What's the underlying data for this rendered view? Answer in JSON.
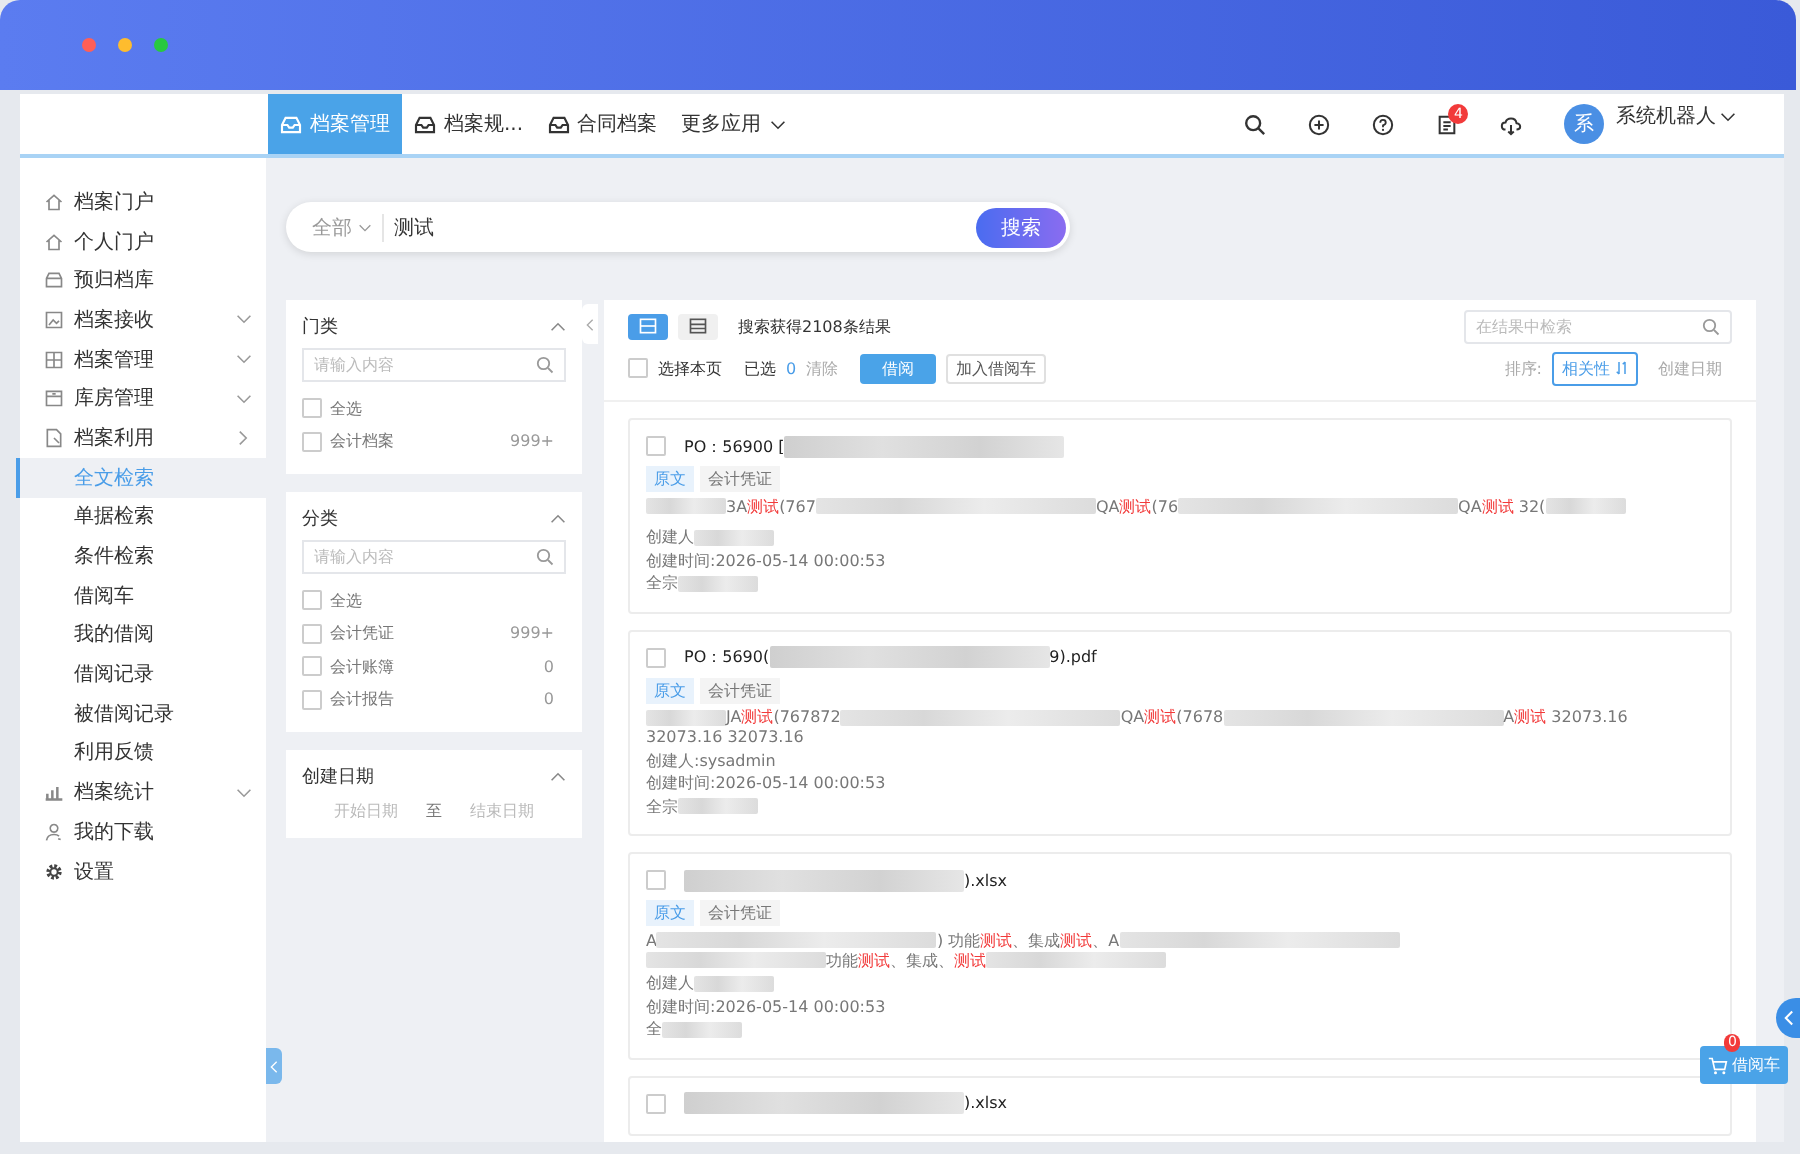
{
  "nav": {
    "tabs": [
      {
        "label": "档案管理",
        "selected": true
      },
      {
        "label": "档案规...",
        "selected": false
      },
      {
        "label": "合同档案",
        "selected": false
      }
    ],
    "more": "更多应用",
    "notification_count": "4",
    "avatar": "系",
    "user": "系统机器人"
  },
  "sidebar": {
    "items": [
      {
        "label": "档案门户"
      },
      {
        "label": "个人门户"
      },
      {
        "label": "预归档库"
      },
      {
        "label": "档案接收",
        "expanded": false
      },
      {
        "label": "档案管理",
        "expanded": false
      },
      {
        "label": "库房管理",
        "expanded": false
      },
      {
        "label": "档案利用",
        "expanded": true,
        "children": [
          {
            "label": "全文检索",
            "selected": true
          },
          {
            "label": "单据检索",
            "selected": false
          },
          {
            "label": "条件检索",
            "selected": false
          },
          {
            "label": "借阅车",
            "selected": false
          },
          {
            "label": "我的借阅",
            "selected": false
          },
          {
            "label": "借阅记录",
            "selected": false
          },
          {
            "label": "被借阅记录",
            "selected": false
          },
          {
            "label": "利用反馈",
            "selected": false
          }
        ]
      },
      {
        "label": "档案统计",
        "expanded": false
      },
      {
        "label": "我的下载"
      },
      {
        "label": "设置"
      }
    ]
  },
  "search": {
    "scope": "全部",
    "value": "测试",
    "button": "搜索"
  },
  "filters": [
    {
      "title": "门类",
      "placeholder": "请输入内容",
      "options": [
        {
          "label": "全选",
          "checked": false
        },
        {
          "label": "会计档案",
          "count": "999+",
          "checked": false
        }
      ]
    },
    {
      "title": "分类",
      "placeholder": "请输入内容",
      "options": [
        {
          "label": "全选",
          "checked": false
        },
        {
          "label": "会计凭证",
          "count": "999+",
          "checked": false
        },
        {
          "label": "会计账簿",
          "count": "0",
          "checked": false
        },
        {
          "label": "会计报告",
          "count": "0",
          "checked": false
        }
      ]
    }
  ],
  "date_filter": {
    "title": "创建日期",
    "start_placeholder": "开始日期",
    "separator": "至",
    "end_placeholder": "结束日期"
  },
  "results": {
    "summary": "搜索获得2108条结果",
    "select_page": "选择本页",
    "select_page_checked": false,
    "selected_label": "已选",
    "selected_count": "0",
    "clear": "清除",
    "borrow": "借阅",
    "add_cart": "加入借阅车",
    "filter_placeholder": "在结果中检索",
    "sort_label": "排序:",
    "sorts": [
      {
        "label": "相关性",
        "selected": true
      },
      {
        "label": "创建日期",
        "selected": false
      }
    ],
    "items": [
      {
        "checked": false,
        "title": [
          {
            "kind": "text",
            "text": "PO：56900 ["
          },
          {
            "kind": "blurlong"
          }
        ],
        "tags": [
          {
            "label": "原文",
            "kind": "primary"
          },
          {
            "label": "会计凭证",
            "kind": "plain"
          }
        ],
        "snippet": [
          [
            {
              "kind": "blurshort"
            },
            {
              "kind": "text",
              "text": "3A"
            },
            {
              "kind": "hit",
              "text": "测试"
            },
            {
              "kind": "text",
              "text": "(767"
            },
            {
              "kind": "blurlong"
            },
            {
              "kind": "text",
              "text": "QA"
            },
            {
              "kind": "hit",
              "text": "测试"
            },
            {
              "kind": "text",
              "text": "(76"
            },
            {
              "kind": "blurlong"
            },
            {
              "kind": "text",
              "text": "QA"
            },
            {
              "kind": "hit",
              "text": "测试"
            },
            {
              "kind": "text",
              "text": " 32("
            },
            {
              "kind": "blurshort"
            }
          ]
        ],
        "meta": [
          [
            {
              "kind": "text",
              "text": "创建人"
            },
            {
              "kind": "blurshort"
            }
          ],
          [
            {
              "kind": "text",
              "text": "创建时间:2026-05-14 00:00:53"
            }
          ],
          [
            {
              "kind": "text",
              "text": "全宗"
            },
            {
              "kind": "blurshort"
            }
          ]
        ]
      },
      {
        "checked": false,
        "title": [
          {
            "kind": "text",
            "text": "PO：5690("
          },
          {
            "kind": "blurlong"
          },
          {
            "kind": "text",
            "text": "9).pdf"
          }
        ],
        "tags": [
          {
            "label": "原文",
            "kind": "primary"
          },
          {
            "label": "会计凭证",
            "kind": "plain"
          }
        ],
        "snippet": [
          [
            {
              "kind": "blurshort"
            },
            {
              "kind": "text",
              "text": "JA"
            },
            {
              "kind": "hit",
              "text": "测试"
            },
            {
              "kind": "text",
              "text": "(767872"
            },
            {
              "kind": "blurlong"
            },
            {
              "kind": "text",
              "text": "QA"
            },
            {
              "kind": "hit",
              "text": "测试"
            },
            {
              "kind": "text",
              "text": "(7678"
            },
            {
              "kind": "blurlong"
            },
            {
              "kind": "text",
              "text": "A"
            },
            {
              "kind": "hit",
              "text": "测试"
            },
            {
              "kind": "text",
              "text": " 32073.16"
            }
          ],
          [
            {
              "kind": "text",
              "text": "32073.16 32073.16"
            }
          ]
        ],
        "meta": [
          [
            {
              "kind": "text",
              "text": "创建人:sysadmin"
            }
          ],
          [
            {
              "kind": "text",
              "text": "创建时间:2026-05-14 00:00:53"
            }
          ],
          [
            {
              "kind": "text",
              "text": "全宗"
            },
            {
              "kind": "blurshort"
            }
          ]
        ]
      },
      {
        "checked": false,
        "title": [
          {
            "kind": "blurlong"
          },
          {
            "kind": "text",
            "text": ").xlsx"
          }
        ],
        "tags": [
          {
            "label": "原文",
            "kind": "primary"
          },
          {
            "label": "会计凭证",
            "kind": "plain"
          }
        ],
        "snippet": [
          [
            {
              "kind": "text",
              "text": "A"
            },
            {
              "kind": "blurlong"
            },
            {
              "kind": "text",
              "text": ") 功能"
            },
            {
              "kind": "hit",
              "text": "测试"
            },
            {
              "kind": "text",
              "text": "、集成"
            },
            {
              "kind": "hit",
              "text": "测试"
            },
            {
              "kind": "text",
              "text": "、A"
            },
            {
              "kind": "blurlong"
            }
          ],
          [
            {
              "kind": "blurmedium"
            },
            {
              "kind": "text",
              "text": "功能"
            },
            {
              "kind": "hit",
              "text": "测试"
            },
            {
              "kind": "text",
              "text": "、集成、"
            },
            {
              "kind": "hit",
              "text": "测试"
            },
            {
              "kind": "blurmedium"
            }
          ]
        ],
        "meta": [
          [
            {
              "kind": "text",
              "text": "创建人"
            },
            {
              "kind": "blurshort"
            }
          ],
          [
            {
              "kind": "text",
              "text": "创建时间:2026-05-14 00:00:53"
            }
          ],
          [
            {
              "kind": "text",
              "text": "全"
            },
            {
              "kind": "blurshort"
            }
          ]
        ]
      },
      {
        "checked": false,
        "title": [
          {
            "kind": "blurlong"
          },
          {
            "kind": "text",
            "text": ").xlsx"
          }
        ]
      }
    ]
  },
  "cart": {
    "label": "借阅车",
    "count": "0"
  }
}
